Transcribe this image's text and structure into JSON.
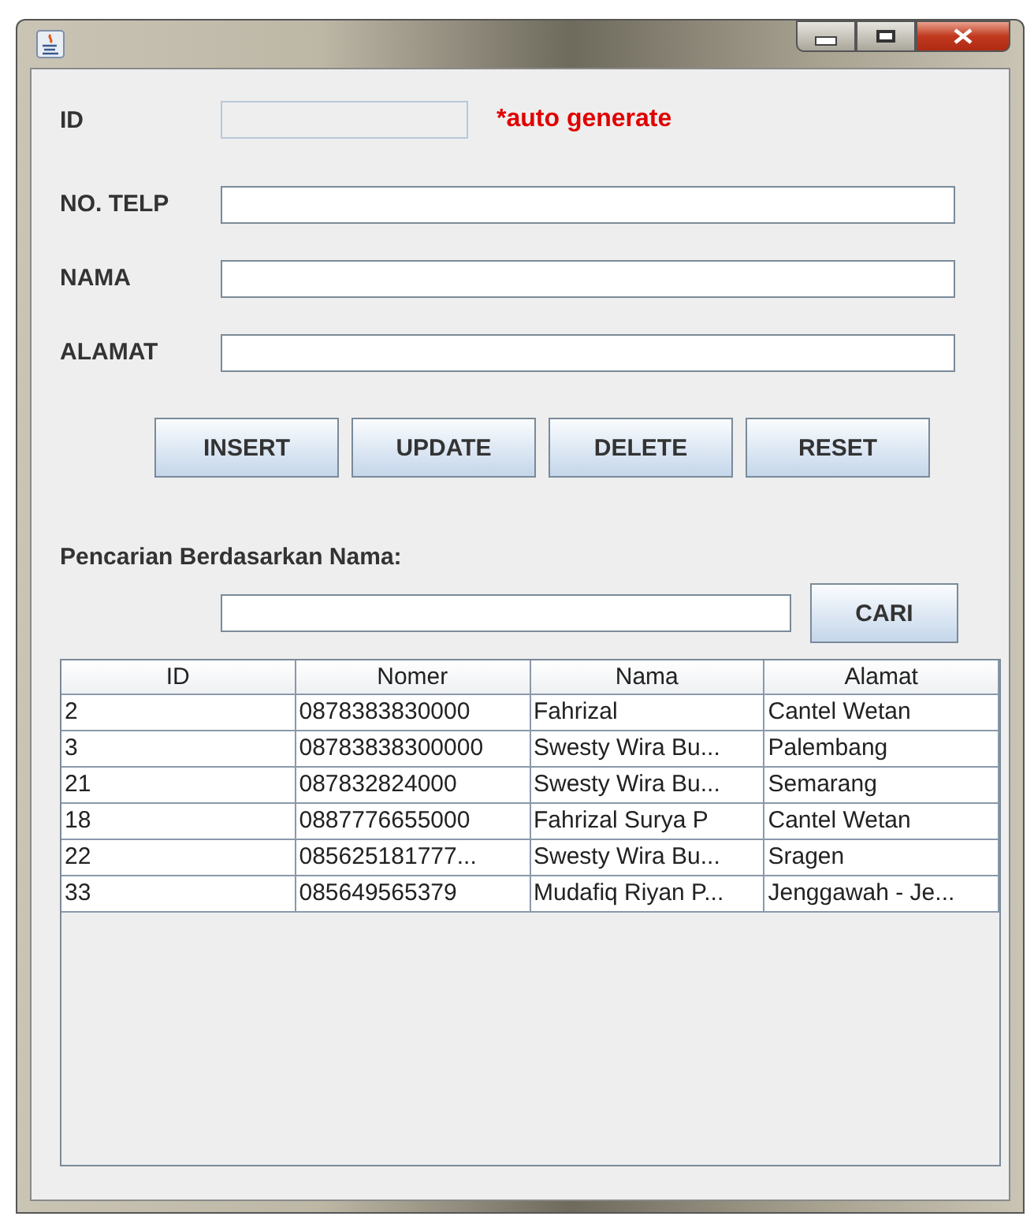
{
  "form": {
    "fields": [
      {
        "label": "ID",
        "disabled": true,
        "note": "*auto generate"
      },
      {
        "label": "NO. TELP",
        "disabled": false
      },
      {
        "label": "NAMA",
        "disabled": false
      },
      {
        "label": "ALAMAT",
        "disabled": false
      }
    ]
  },
  "buttons": [
    "INSERT",
    "UPDATE",
    "DELETE",
    "RESET"
  ],
  "search": {
    "label": "Pencarian Berdasarkan Nama:",
    "button": "CARI"
  },
  "table": {
    "columns": [
      "ID",
      "Nomer",
      "Nama",
      "Alamat"
    ],
    "rows": [
      [
        "2",
        "0878383830000",
        "Fahrizal",
        "Cantel Wetan"
      ],
      [
        "3",
        "08783838300000",
        "Swesty Wira Bu...",
        "Palembang"
      ],
      [
        "21",
        "087832824000",
        "Swesty Wira Bu...",
        "Semarang"
      ],
      [
        "18",
        "0887776655000",
        "Fahrizal Surya P",
        "Cantel Wetan"
      ],
      [
        "22",
        "085625181777...",
        "Swesty Wira Bu...",
        "Sragen"
      ],
      [
        "33",
        "085649565379",
        "Mudafiq Riyan P...",
        "Jenggawah - Je..."
      ]
    ]
  }
}
